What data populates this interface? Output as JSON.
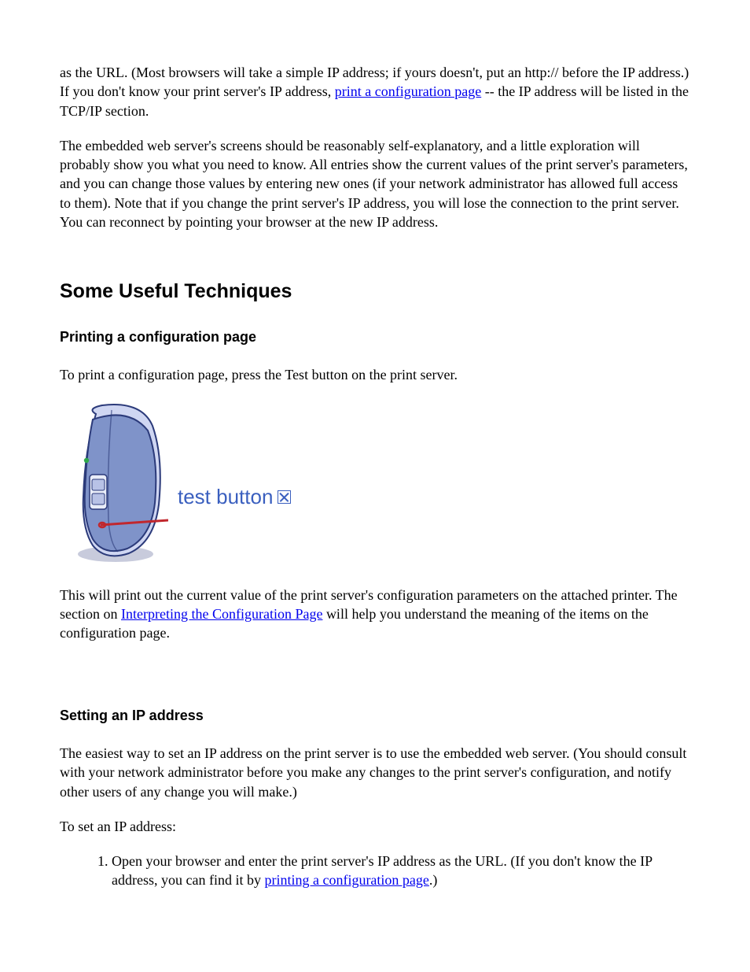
{
  "intro": {
    "para1_a": "as the URL. (Most browsers will take a simple IP address; if yours doesn't, put an http:// before the IP address.) If you don't know your print server's IP address, ",
    "para1_link": "print a configuration page",
    "para1_b": " -- the IP address will be listed in the TCP/IP section.",
    "para2": "The embedded web server's screens should be reasonably self-explanatory, and a little exploration will probably show you what you need to know. All entries show the current values of the print server's parameters, and you can change those values by entering new ones (if your network administrator has allowed full access to them). Note that if you change the print server's IP address, you will lose the connection to the print server. You can reconnect by pointing your browser at the new IP address."
  },
  "techniques": {
    "heading": "Some Useful Techniques",
    "config_page": {
      "heading": "Printing a configuration page",
      "para1": "To print a configuration page, press the Test button on the print server.",
      "figure_label": "test button",
      "para2_a": "This will print out the current value of the print server's configuration parameters on the attached printer. The section on ",
      "para2_link": "Interpreting the Configuration Page",
      "para2_b": " will help you understand the meaning of the items on the configuration page."
    },
    "ip_address": {
      "heading": "Setting an IP address",
      "para1": "The easiest way to set an IP address on the print server is to use the embedded web server. (You should consult with your network administrator before you make any changes to the print server's configuration, and notify other users of any change you will make.)",
      "para2": "To set an IP address:",
      "step1_a": "Open your browser and enter the print server's IP address as the URL. (If you don't know the IP address, you can find it by ",
      "step1_link": "printing a configuration page",
      "step1_b": ".)"
    }
  }
}
